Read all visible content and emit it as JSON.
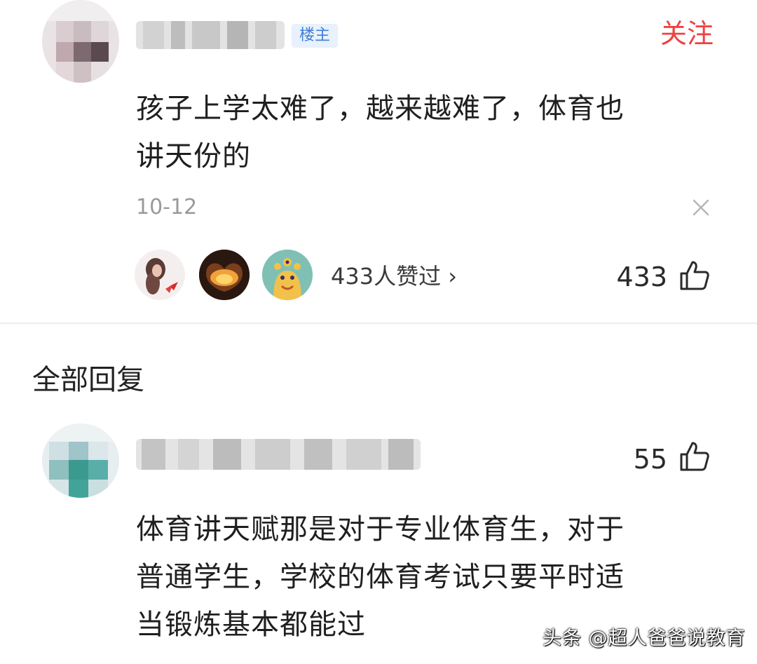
{
  "op_comment": {
    "badge": "楼主",
    "follow_label": "关注",
    "text_line1": "孩子上学太难了，越来越难了，体育也",
    "text_line2": "讲天份的",
    "date": "10-12",
    "likes_summary": "433人赞过 ›",
    "like_count": "433"
  },
  "replies_section": {
    "title": "全部回复"
  },
  "reply": {
    "like_count": "55",
    "text_line1": "体育讲天赋那是对于专业体育生，对于",
    "text_line2": "普通学生，学校的体育考试只要平时适",
    "text_line3": "当锻炼基本都能过"
  },
  "watermark": "头条 @超人爸爸说教育",
  "colors": {
    "follow": "#f04142",
    "badge_bg": "#e8f1fc",
    "badge_text": "#3f7fd6",
    "meta_gray": "#9a9a9a"
  },
  "icons": [
    "thumbs-up-icon",
    "close-icon"
  ]
}
